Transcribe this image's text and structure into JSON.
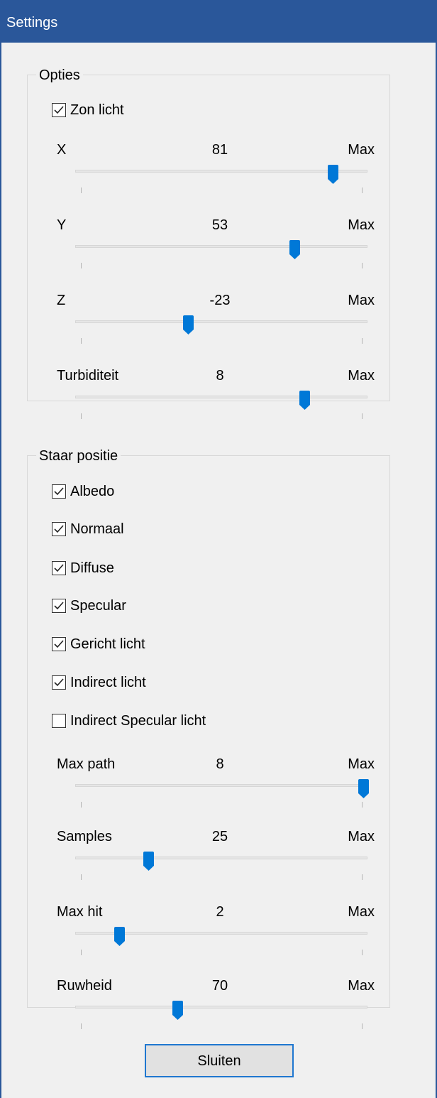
{
  "window": {
    "title": "Settings"
  },
  "opties": {
    "title": "Opties",
    "checkbox": {
      "label": "Zon licht",
      "checked": true
    },
    "sliders": [
      {
        "label": "X",
        "value": "81",
        "max_label": "Max",
        "fraction": 0.88
      },
      {
        "label": "Y",
        "value": "53",
        "max_label": "Max",
        "fraction": 0.75
      },
      {
        "label": "Z",
        "value": "-23",
        "max_label": "Max",
        "fraction": 0.385
      },
      {
        "label": "Turbiditeit",
        "value": "8",
        "max_label": "Max",
        "fraction": 0.785
      }
    ]
  },
  "staar": {
    "title": "Staar positie",
    "checkboxes": [
      {
        "label": "Albedo",
        "checked": true
      },
      {
        "label": "Normaal",
        "checked": true
      },
      {
        "label": "Diffuse",
        "checked": true
      },
      {
        "label": "Specular",
        "checked": true
      },
      {
        "label": "Gericht licht",
        "checked": true
      },
      {
        "label": "Indirect licht",
        "checked": true
      },
      {
        "label": "Indirect Specular licht",
        "checked": false
      }
    ],
    "sliders": [
      {
        "label": "Max path",
        "value": "8",
        "max_label": "Max",
        "fraction": 0.985
      },
      {
        "label": "Samples",
        "value": "25",
        "max_label": "Max",
        "fraction": 0.25
      },
      {
        "label": "Max hit",
        "value": "2",
        "max_label": "Max",
        "fraction": 0.15
      },
      {
        "label": "Ruwheid",
        "value": "70",
        "max_label": "Max",
        "fraction": 0.35
      }
    ]
  },
  "close_button": {
    "label": "Sluiten"
  },
  "colors": {
    "accent": "#0078d7",
    "titlebar": "#2a579a"
  },
  "icons": {
    "check": "checkmark-icon",
    "thumb": "slider-thumb-icon"
  }
}
